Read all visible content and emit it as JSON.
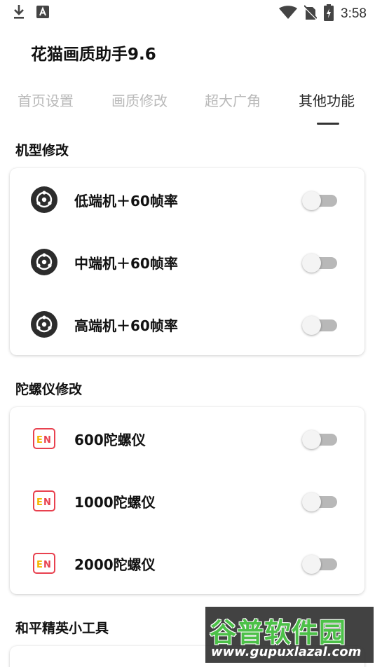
{
  "status_bar": {
    "time": "3:58",
    "icons": [
      "download-icon",
      "a-notification-icon",
      "wifi-icon",
      "no-sim-icon",
      "battery-charging-icon"
    ]
  },
  "app": {
    "title": "花猫画质助手9.6"
  },
  "tabs": [
    {
      "label": "首页设置",
      "active": false
    },
    {
      "label": "画质修改",
      "active": false
    },
    {
      "label": "超大广角",
      "active": false
    },
    {
      "label": "其他功能",
      "active": true
    }
  ],
  "sections": [
    {
      "title": "机型修改",
      "icon": "device-target-icon",
      "items": [
        {
          "label": "低端机＋60帧率",
          "enabled": false
        },
        {
          "label": "中端机＋60帧率",
          "enabled": false
        },
        {
          "label": "高端机＋60帧率",
          "enabled": false
        }
      ]
    },
    {
      "title": "陀螺仪修改",
      "icon": "en-badge-icon",
      "items": [
        {
          "label": "600陀螺仪",
          "enabled": false
        },
        {
          "label": "1000陀螺仪",
          "enabled": false
        },
        {
          "label": "2000陀螺仪",
          "enabled": false
        }
      ]
    },
    {
      "title": "和平精英小工具"
    }
  ],
  "watermark": {
    "main": "谷普软件园",
    "url": "www.gupuxlazal.com"
  },
  "colors": {
    "accent_text": "#2a2a2a",
    "inactive_tab": "#b9b9b9",
    "toggle_off_track": "#b8b8b8",
    "en_icon_red": "#e8414f",
    "en_icon_yellow": "#f5b400",
    "watermark_green": "#4cc048"
  }
}
